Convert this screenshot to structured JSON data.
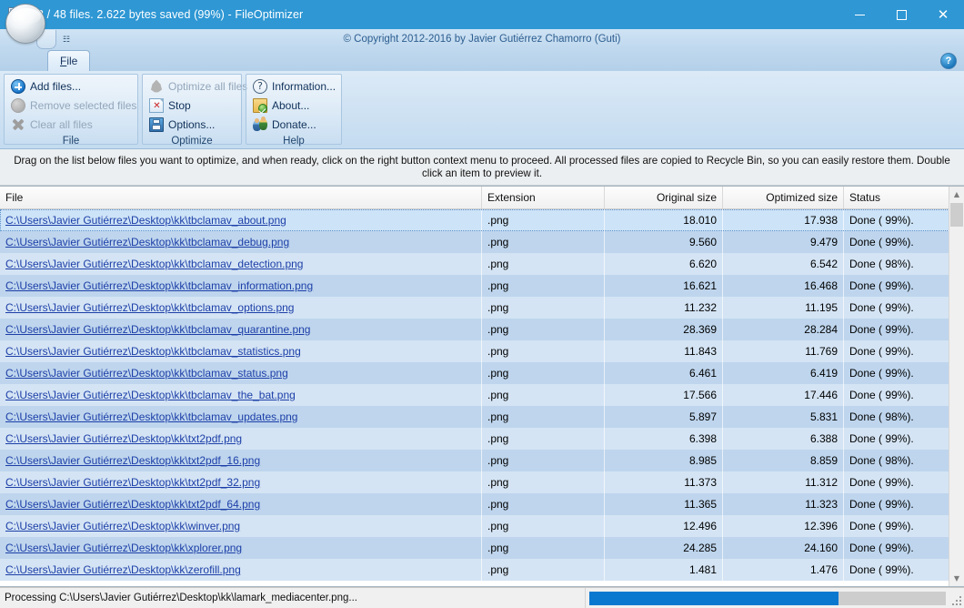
{
  "window": {
    "title": "33 / 48 files. 2.622 bytes saved (99%) - FileOptimizer",
    "app_icon": "fileoptimizer-icon",
    "minimize_label": "",
    "maximize_label": "",
    "close_label": "✕"
  },
  "ribbon": {
    "copyright": "© Copyright 2012-2016 by Javier Gutiérrez Chamorro (Guti)",
    "qat_dropdown": "☷",
    "help_label": "?",
    "tabs": [
      {
        "label": "File",
        "active": true
      }
    ],
    "groups": [
      {
        "name": "File",
        "label": "File",
        "items": [
          {
            "label": "Add files...",
            "icon": "add-plus-icon",
            "enabled": true
          },
          {
            "label": "Remove selected files",
            "icon": "remove-circle-icon",
            "enabled": false
          },
          {
            "label": "Clear all files",
            "icon": "clear-x-icon",
            "enabled": false
          }
        ]
      },
      {
        "name": "Optimize",
        "label": "Optimize",
        "items": [
          {
            "label": "Optimize all files",
            "icon": "optimize-gem-icon",
            "enabled": false
          },
          {
            "label": "Stop",
            "icon": "stop-page-icon",
            "enabled": true
          },
          {
            "label": "Options...",
            "icon": "options-floppy-icon",
            "enabled": true
          }
        ]
      },
      {
        "name": "Help",
        "label": "Help",
        "items": [
          {
            "label": "Information...",
            "icon": "information-question-icon",
            "enabled": true
          },
          {
            "label": "About...",
            "icon": "about-badge-icon",
            "enabled": true
          },
          {
            "label": "Donate...",
            "icon": "donate-people-icon",
            "enabled": true
          }
        ]
      }
    ]
  },
  "banner": {
    "text": "Drag on the list below files you want to optimize, and when ready, click on the right button context menu to proceed. All processed files are copied to Recycle Bin, so you can easily restore them. Double click an item to preview it."
  },
  "list": {
    "columns": [
      "File",
      "Extension",
      "Original size",
      "Optimized size",
      "Status"
    ],
    "rows": [
      {
        "file": "C:\\Users\\Javier Gutiérrez\\Desktop\\kk\\tbclamav_about.png",
        "ext": ".png",
        "original": "18.010",
        "optimized": "17.938",
        "status": "Done ( 99%).",
        "selected": true
      },
      {
        "file": "C:\\Users\\Javier Gutiérrez\\Desktop\\kk\\tbclamav_debug.png",
        "ext": ".png",
        "original": "9.560",
        "optimized": "9.479",
        "status": "Done ( 99%)."
      },
      {
        "file": "C:\\Users\\Javier Gutiérrez\\Desktop\\kk\\tbclamav_detection.png",
        "ext": ".png",
        "original": "6.620",
        "optimized": "6.542",
        "status": "Done ( 98%)."
      },
      {
        "file": "C:\\Users\\Javier Gutiérrez\\Desktop\\kk\\tbclamav_information.png",
        "ext": ".png",
        "original": "16.621",
        "optimized": "16.468",
        "status": "Done ( 99%)."
      },
      {
        "file": "C:\\Users\\Javier Gutiérrez\\Desktop\\kk\\tbclamav_options.png",
        "ext": ".png",
        "original": "11.232",
        "optimized": "11.195",
        "status": "Done ( 99%)."
      },
      {
        "file": "C:\\Users\\Javier Gutiérrez\\Desktop\\kk\\tbclamav_quarantine.png",
        "ext": ".png",
        "original": "28.369",
        "optimized": "28.284",
        "status": "Done ( 99%)."
      },
      {
        "file": "C:\\Users\\Javier Gutiérrez\\Desktop\\kk\\tbclamav_statistics.png",
        "ext": ".png",
        "original": "11.843",
        "optimized": "11.769",
        "status": "Done ( 99%)."
      },
      {
        "file": "C:\\Users\\Javier Gutiérrez\\Desktop\\kk\\tbclamav_status.png",
        "ext": ".png",
        "original": "6.461",
        "optimized": "6.419",
        "status": "Done ( 99%)."
      },
      {
        "file": "C:\\Users\\Javier Gutiérrez\\Desktop\\kk\\tbclamav_the_bat.png",
        "ext": ".png",
        "original": "17.566",
        "optimized": "17.446",
        "status": "Done ( 99%)."
      },
      {
        "file": "C:\\Users\\Javier Gutiérrez\\Desktop\\kk\\tbclamav_updates.png",
        "ext": ".png",
        "original": "5.897",
        "optimized": "5.831",
        "status": "Done ( 98%)."
      },
      {
        "file": "C:\\Users\\Javier Gutiérrez\\Desktop\\kk\\txt2pdf.png",
        "ext": ".png",
        "original": "6.398",
        "optimized": "6.388",
        "status": "Done ( 99%)."
      },
      {
        "file": "C:\\Users\\Javier Gutiérrez\\Desktop\\kk\\txt2pdf_16.png",
        "ext": ".png",
        "original": "8.985",
        "optimized": "8.859",
        "status": "Done ( 98%)."
      },
      {
        "file": "C:\\Users\\Javier Gutiérrez\\Desktop\\kk\\txt2pdf_32.png",
        "ext": ".png",
        "original": "11.373",
        "optimized": "11.312",
        "status": "Done ( 99%)."
      },
      {
        "file": "C:\\Users\\Javier Gutiérrez\\Desktop\\kk\\txt2pdf_64.png",
        "ext": ".png",
        "original": "11.365",
        "optimized": "11.323",
        "status": "Done ( 99%)."
      },
      {
        "file": "C:\\Users\\Javier Gutiérrez\\Desktop\\kk\\winver.png",
        "ext": ".png",
        "original": "12.496",
        "optimized": "12.396",
        "status": "Done ( 99%)."
      },
      {
        "file": "C:\\Users\\Javier Gutiérrez\\Desktop\\kk\\xplorer.png",
        "ext": ".png",
        "original": "24.285",
        "optimized": "24.160",
        "status": "Done ( 99%)."
      },
      {
        "file": "C:\\Users\\Javier Gutiérrez\\Desktop\\kk\\zerofill.png",
        "ext": ".png",
        "original": "1.481",
        "optimized": "1.476",
        "status": "Done ( 99%)."
      }
    ],
    "scroll_up": "▲",
    "scroll_down": "▼"
  },
  "statusbar": {
    "message": "Processing C:\\Users\\Javier Gutiérrez\\Desktop\\kk\\lamark_mediacenter.png...",
    "progress_percent": 70
  },
  "colors": {
    "titlebar": "#2e97d4",
    "accent": "#0b78d0",
    "row_odd": "#d4e4f4",
    "row_even": "#bed5ed",
    "link": "#1d3fa8"
  }
}
